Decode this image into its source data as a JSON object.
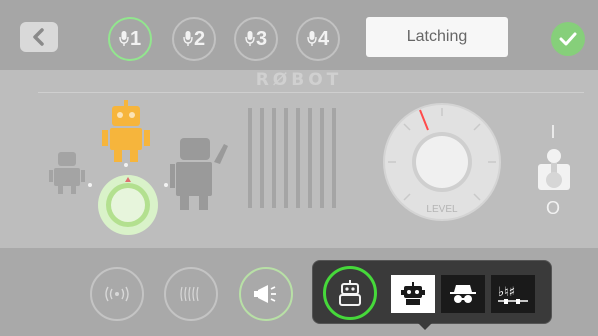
{
  "colors": {
    "active_green": "#92e68e",
    "confirm_green": "#86cf7a",
    "robot_orange": "#f6b53c",
    "selector_ring": "#46d93a",
    "level_needle": "#ff4a4a"
  },
  "header": {
    "back_icon": "chevron-left-icon",
    "mic_channels": [
      {
        "label": "1",
        "active": true
      },
      {
        "label": "2",
        "active": false
      },
      {
        "label": "3",
        "active": false
      },
      {
        "label": "4",
        "active": false
      }
    ],
    "mode_button": "Latching",
    "confirm_icon": "checkmark-icon"
  },
  "section_title": "RØBOT",
  "knob": {
    "label": "LEVEL"
  },
  "toggle": {
    "top_label": "I",
    "bottom_label": "O"
  },
  "bottom_bar": {
    "buttons": [
      "broadcast-icon",
      "wave-icon",
      "megaphone-icon"
    ]
  },
  "voice_popup": {
    "options": [
      "robot-icon",
      "robot-icon",
      "spy-icon",
      "pitch-shift-icon"
    ],
    "selected_index": 1
  }
}
